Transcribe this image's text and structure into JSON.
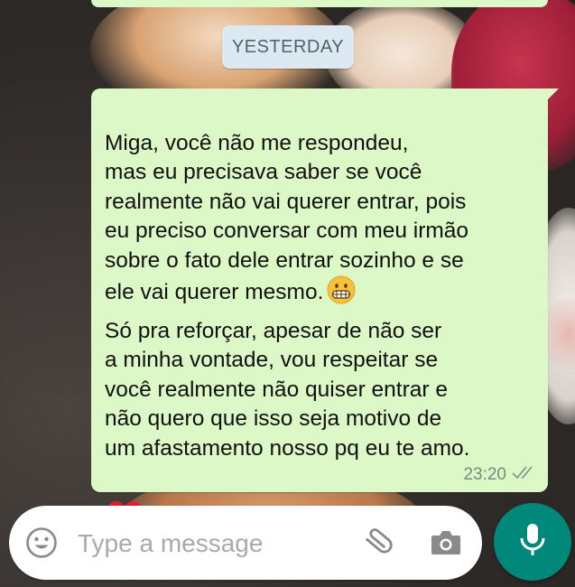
{
  "chat": {
    "date_chip": "YESTERDAY",
    "message": {
      "paragraph1": "Miga, você não me respondeu,\nmas eu precisava saber se você\nrealmente não vai querer entrar, pois\neu preciso conversar com meu irmão\nsobre o fato dele entrar sozinho e se\nele vai querer mesmo.",
      "paragraph2": "Só pra reforçar, apesar de  não ser\na minha vontade, vou respeitar se\nvocê realmente não quiser entrar e\nnão quero que isso seja motivo de\num afastamento nosso pq eu te amo.",
      "emojis": [
        "grimacing-face-emoji",
        "red-heart-emoji"
      ],
      "time": "23:20",
      "status_icon": "double-check-icon"
    }
  },
  "composer": {
    "placeholder": "Type a message",
    "icons": [
      "emoji-icon",
      "paperclip-icon",
      "camera-icon",
      "microphone-icon"
    ],
    "accent_color": "#00897b"
  },
  "colors": {
    "outgoing_bubble": "#dcf8c6",
    "date_chip_bg": "#dce9f2"
  }
}
